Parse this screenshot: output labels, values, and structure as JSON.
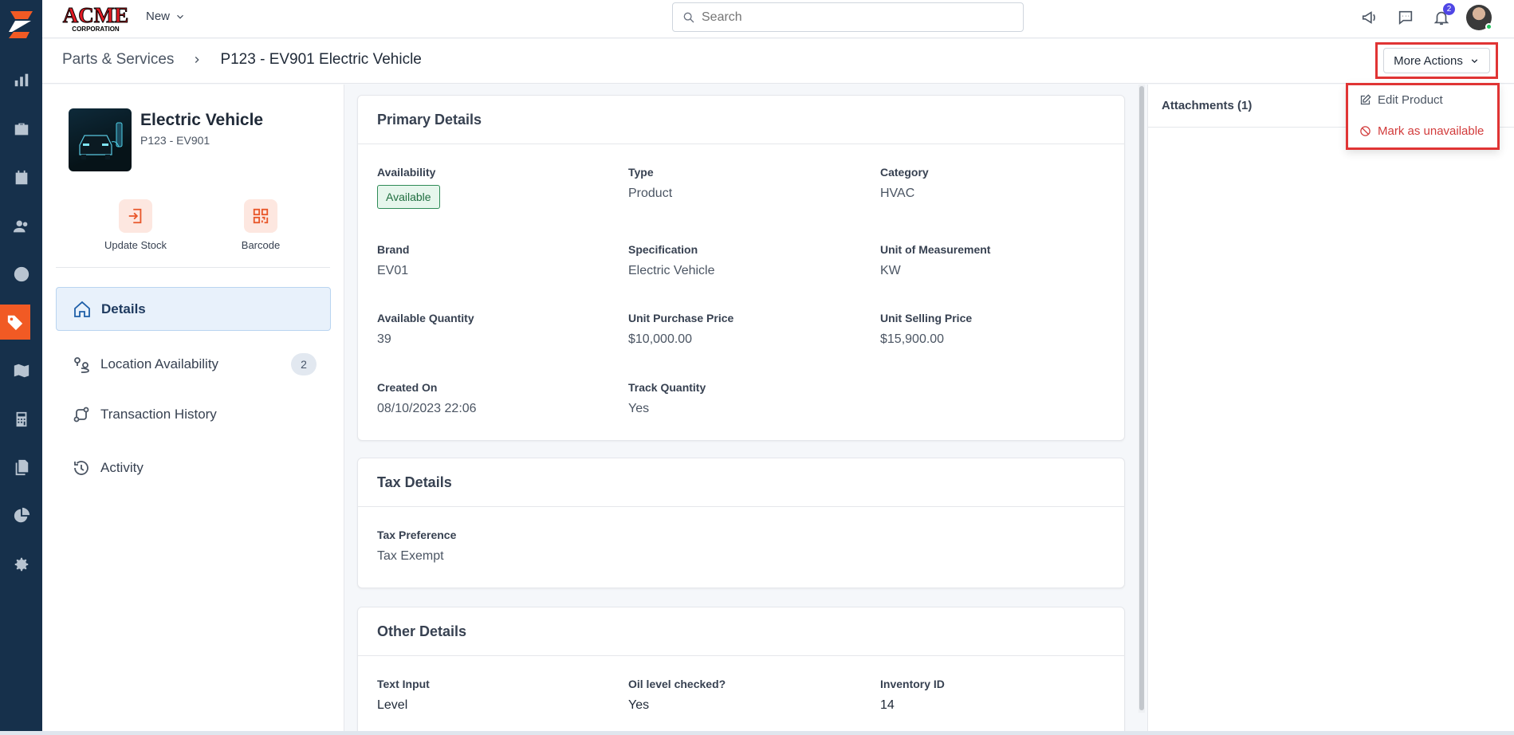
{
  "topbar": {
    "brand_name": "ACME",
    "brand_sub": "CORPORATION",
    "new_label": "New",
    "search_placeholder": "Search",
    "notification_count": "2"
  },
  "breadcrumb": {
    "parent": "Parts & Services",
    "current": "P123 - EV901 Electric Vehicle"
  },
  "actions": {
    "more_label": "More Actions",
    "menu": {
      "edit": "Edit Product",
      "unavailable": "Mark as unavailable"
    }
  },
  "product": {
    "name": "Electric Vehicle",
    "code": "P123 - EV901"
  },
  "quick_actions": {
    "update_stock": "Update Stock",
    "barcode": "Barcode"
  },
  "nav": {
    "details": "Details",
    "location": "Location Availability",
    "location_count": "2",
    "transactions": "Transaction History",
    "activity": "Activity"
  },
  "primary": {
    "title": "Primary Details",
    "availability_label": "Availability",
    "availability_value": "Available",
    "type_label": "Type",
    "type_value": "Product",
    "category_label": "Category",
    "category_value": "HVAC",
    "brand_label": "Brand",
    "brand_value": "EV01",
    "spec_label": "Specification",
    "spec_value": "Electric Vehicle",
    "uom_label": "Unit of Measurement",
    "uom_value": "KW",
    "qty_label": "Available Quantity",
    "qty_value": "39",
    "purchase_label": "Unit Purchase Price",
    "purchase_value": "$10,000.00",
    "selling_label": "Unit Selling Price",
    "selling_value": "$15,900.00",
    "created_label": "Created On",
    "created_value": "08/10/2023 22:06",
    "track_label": "Track Quantity",
    "track_value": "Yes"
  },
  "tax": {
    "title": "Tax Details",
    "pref_label": "Tax Preference",
    "pref_value": "Tax Exempt"
  },
  "other": {
    "title": "Other Details",
    "text_label": "Text Input",
    "text_value": "Level",
    "oil_label": "Oil level checked?",
    "oil_value": "Yes",
    "inv_label": "Inventory ID",
    "inv_value": "14"
  },
  "attachments": {
    "title": "Attachments (1)"
  },
  "colors": {
    "rail": "#16304b",
    "accent": "#f15a24",
    "highlight": "#e03434"
  }
}
